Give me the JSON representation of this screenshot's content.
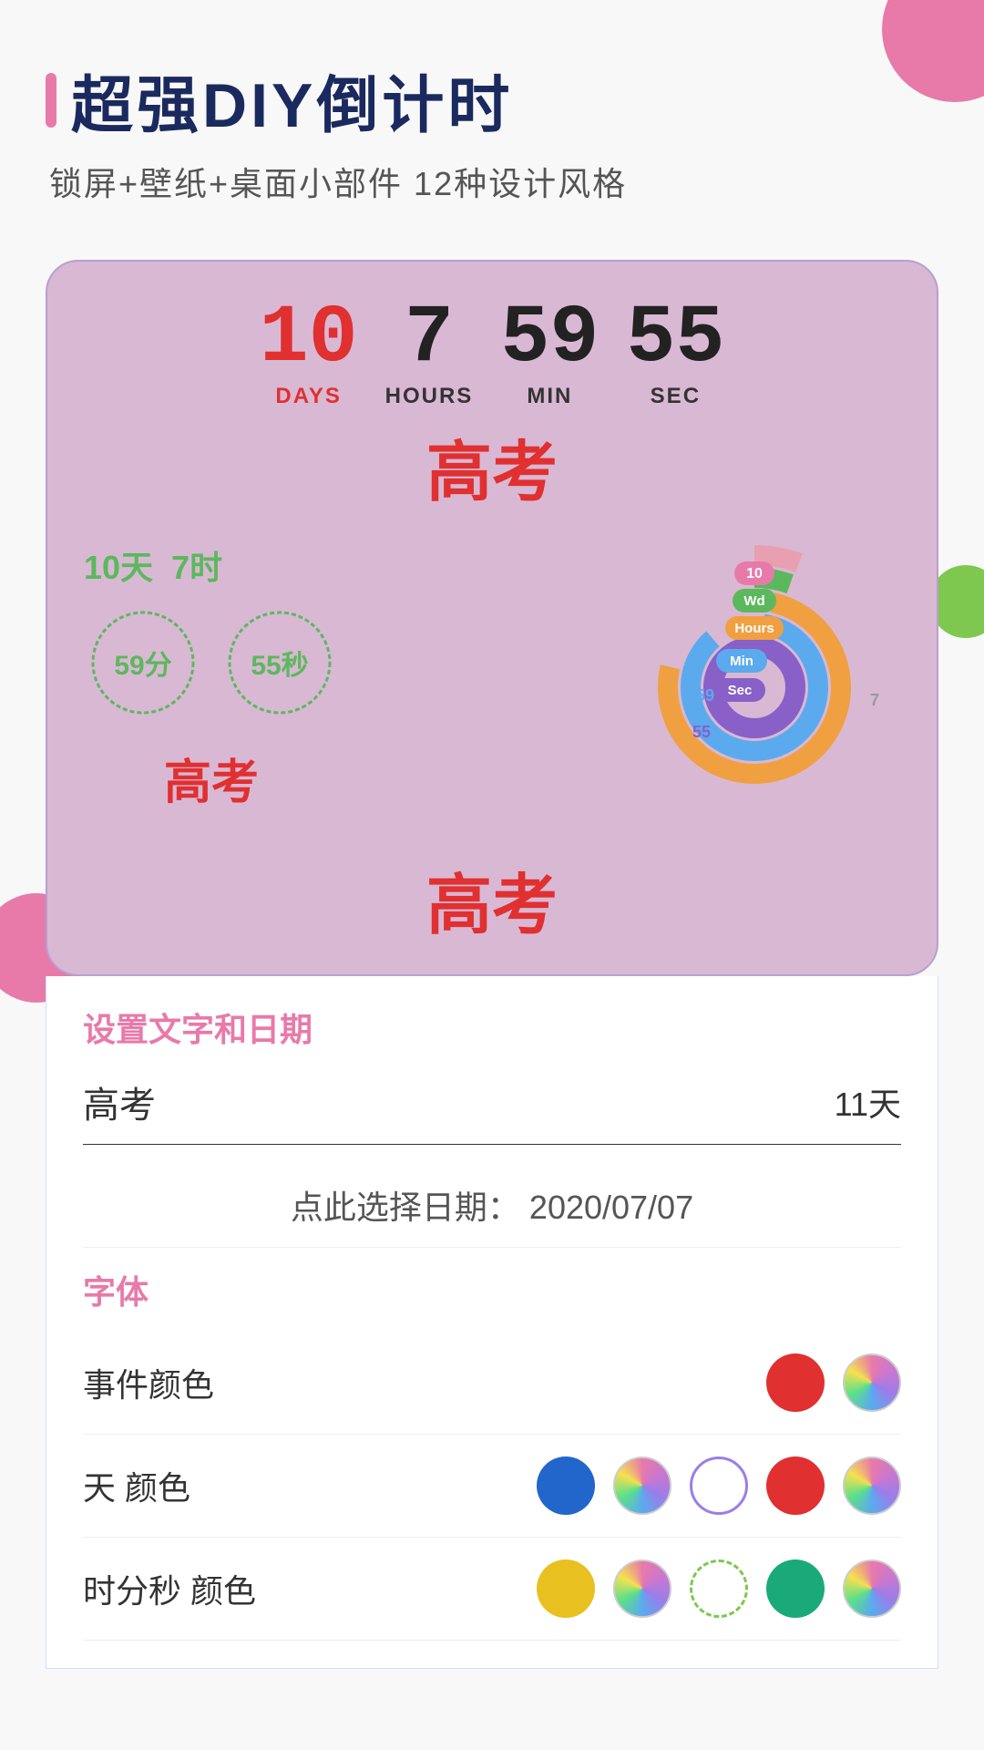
{
  "header": {
    "bar_color": "#e87aaa",
    "title": "超强DIY倒计时",
    "subtitle": "锁屏+壁纸+桌面小部件  12种设计风格"
  },
  "preview": {
    "timer": {
      "days_value": "10",
      "days_label": "DAYS",
      "hours_value": "7",
      "hours_label": "HOURS",
      "min_value": "59",
      "min_label": "MIN",
      "sec_value": "55",
      "sec_label": "SEC"
    },
    "event_title": "高考",
    "left_widget": {
      "days_text": "10天",
      "hours_text": "7时",
      "min_text": "59分",
      "sec_text": "55秒",
      "event_label": "高考"
    },
    "donut_labels": [
      {
        "label": "10",
        "color": "#e87aaa"
      },
      {
        "label": "Wd",
        "color": "#5cb85c"
      },
      {
        "label": "Hours",
        "color": "#f0a040"
      },
      {
        "label": "59",
        "color": "#5baaee"
      },
      {
        "label": "Min",
        "color": "#5baaee"
      },
      {
        "label": "55",
        "color": "#8860c8"
      },
      {
        "label": "Sec",
        "color": "#8860c8"
      },
      {
        "label": "7",
        "color": "#999"
      }
    ],
    "bottom_title": "高考"
  },
  "settings": {
    "section_title": "设置文字和日期",
    "event_input_value": "高考",
    "days_value": "11天",
    "date_select_label": "点此选择日期：",
    "date_value": "2020/07/07",
    "font_section_title": "字体",
    "colors": [
      {
        "label": "事件颜色",
        "swatches": [
          {
            "type": "solid",
            "color": "#e03030"
          },
          {
            "type": "floral",
            "color": "floral"
          }
        ]
      },
      {
        "label": "天 颜色",
        "swatches": [
          {
            "type": "solid",
            "color": "#2266cc"
          },
          {
            "type": "floral",
            "color": "floral"
          },
          {
            "type": "floral-outline",
            "color": "floral-outline"
          },
          {
            "type": "solid",
            "color": "#e03030"
          },
          {
            "type": "floral",
            "color": "floral"
          }
        ]
      },
      {
        "label": "时分秒 颜色",
        "swatches": [
          {
            "type": "solid",
            "color": "#e8c020"
          },
          {
            "type": "floral",
            "color": "floral"
          },
          {
            "type": "floral-outline-green",
            "color": "floral-outline-green"
          },
          {
            "type": "solid",
            "color": "#1aaa7a"
          },
          {
            "type": "floral",
            "color": "floral"
          }
        ]
      }
    ]
  },
  "icons": {
    "accent_bar": "▌"
  }
}
